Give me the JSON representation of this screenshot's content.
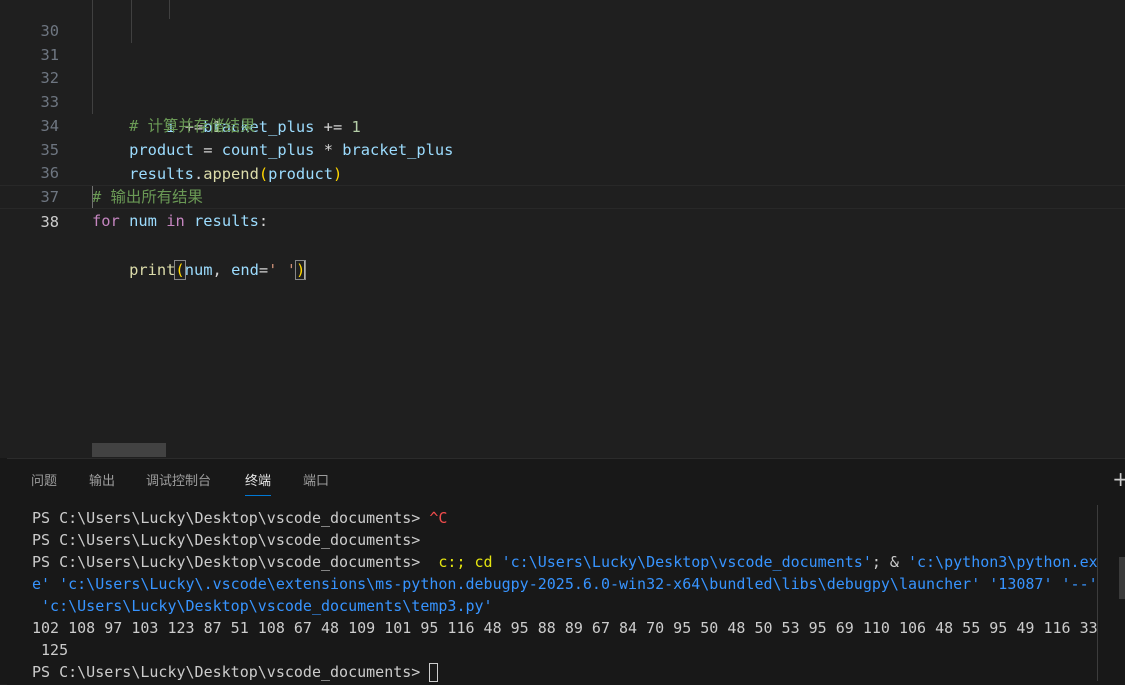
{
  "editor": {
    "lines": {
      "l30": {
        "num": "30",
        "indent": "            ",
        "a": "bracket_plus",
        "b": " += ",
        "c": "1"
      },
      "l31": {
        "num": "31",
        "indent": "        ",
        "a": "i",
        "b": " += ",
        "c": "1"
      },
      "l32": {
        "num": "32",
        "indent": "    ",
        "comment": "# 计算并存储结果"
      },
      "l33": {
        "num": "33",
        "indent": "    ",
        "a": "product",
        "b": " = ",
        "c": "count_plus",
        "d": " * ",
        "e": "bracket_plus"
      },
      "l34": {
        "num": "34",
        "indent": "    ",
        "a": "results",
        "b": ".",
        "c": "append",
        "d": "(",
        "e": "product",
        "f": ")"
      },
      "l35": {
        "num": "35"
      },
      "l36": {
        "num": "36",
        "comment": "# 输出所有结果"
      },
      "l37": {
        "num": "37",
        "a": "for",
        "b": " ",
        "c": "num",
        "d": " ",
        "e": "in",
        "f": " ",
        "g": "results",
        "h": ":"
      },
      "l38": {
        "num": "38",
        "indent": "    ",
        "a": "print",
        "b": "(",
        "c": "num",
        "d": ", ",
        "e": "end",
        "f": "=",
        "g": "' '",
        "h": ")"
      }
    }
  },
  "panel": {
    "tabs": [
      "问题",
      "输出",
      "调试控制台",
      "终端",
      "端口"
    ],
    "active_tab": "终端",
    "terminal": {
      "prompt": "PS C:\\Users\\Lucky\\Desktop\\vscode_documents>",
      "l1_ctrl": " ^C",
      "l3_pre": "  c:; ",
      "l3_cd": "cd",
      "l3_path": "'c:\\Users\\Lucky\\Desktop\\vscode_documents'",
      "l3_mid": "; & ",
      "l3_py": "'c:\\python3\\python.ex",
      "l4": "e' 'c:\\Users\\Lucky\\.vscode\\extensions\\ms-python.debugpy-2025.6.0-win32-x64\\bundled\\libs\\debugpy\\launcher' '13087' '--'",
      "l5": " 'c:\\Users\\Lucky\\Desktop\\vscode_documents\\temp3.py'",
      "l6": "102 108 97 103 123 87 51 108 67 48 109 101 95 116 48 95 88 89 67 84 70 95 50 48 50 53 95 69 110 106 48 55 95 49 116 33",
      "l7": " 125"
    }
  },
  "colors": {
    "background": "#1f1f1f",
    "panel_background": "#181818",
    "keyword": "#c586c0",
    "variable": "#9cdcfe",
    "function": "#dcdcaa",
    "number": "#b5cea8",
    "string": "#ce9178",
    "comment": "#6a9955",
    "terminal_string": "#3794ff",
    "terminal_command": "#e5e510",
    "terminal_error": "#f14c4c",
    "accent": "#0078d4"
  }
}
